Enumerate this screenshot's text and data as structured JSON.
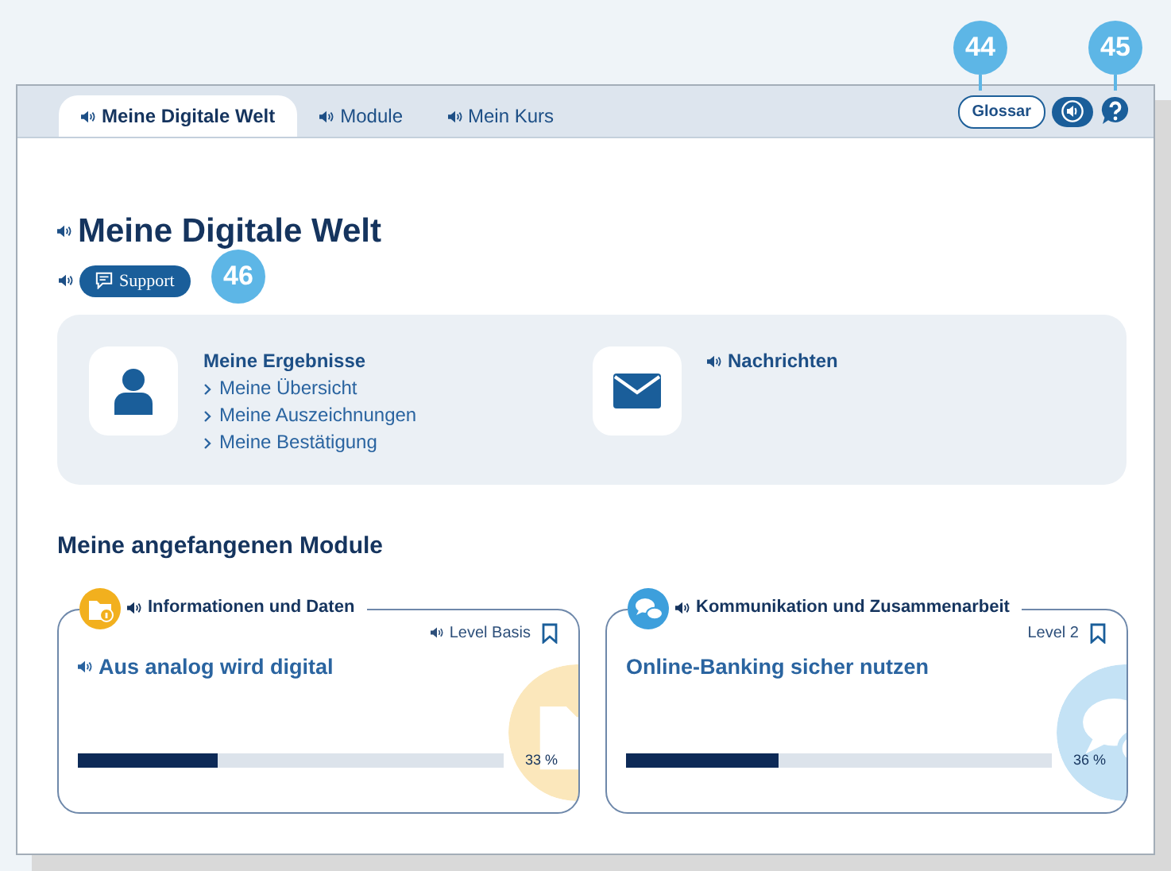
{
  "tabs": [
    {
      "label": "Meine Digitale Welt",
      "selected": true
    },
    {
      "label": "Module",
      "selected": false
    },
    {
      "label": "Mein Kurs",
      "selected": false
    }
  ],
  "toolbar": {
    "glossary": "Glossar"
  },
  "callouts": [
    {
      "number": "44"
    },
    {
      "number": "45"
    },
    {
      "number": "46"
    }
  ],
  "page_title": "Meine Digitale Welt",
  "support_button": "Support",
  "overview": [
    {
      "kind": "results",
      "title": "Meine Ergebnisse",
      "audio": false,
      "links": [
        "Meine Übersicht",
        "Meine Auszeichnungen",
        "Meine Bestätigung"
      ]
    },
    {
      "kind": "messages",
      "title": "Nachrichten",
      "audio": true
    }
  ],
  "section_title": "Meine angefangenen Module",
  "modules": [
    {
      "kind": "info",
      "color": "#f2b01e",
      "category": "Informationen und Daten",
      "level_label": "Level Basis",
      "level_audio": true,
      "title": "Aus analog wird digital",
      "title_audio": true,
      "level": 0.33,
      "progress_text": "33 %"
    },
    {
      "kind": "chat",
      "color": "#3d9fdc",
      "category": "Kommunikation und Zusammenarbeit",
      "level_label": "Level 2",
      "level_audio": false,
      "title": "Online-Banking sicher nutzen",
      "title_audio": false,
      "level": 0.36,
      "progress_text": "36 %"
    }
  ]
}
